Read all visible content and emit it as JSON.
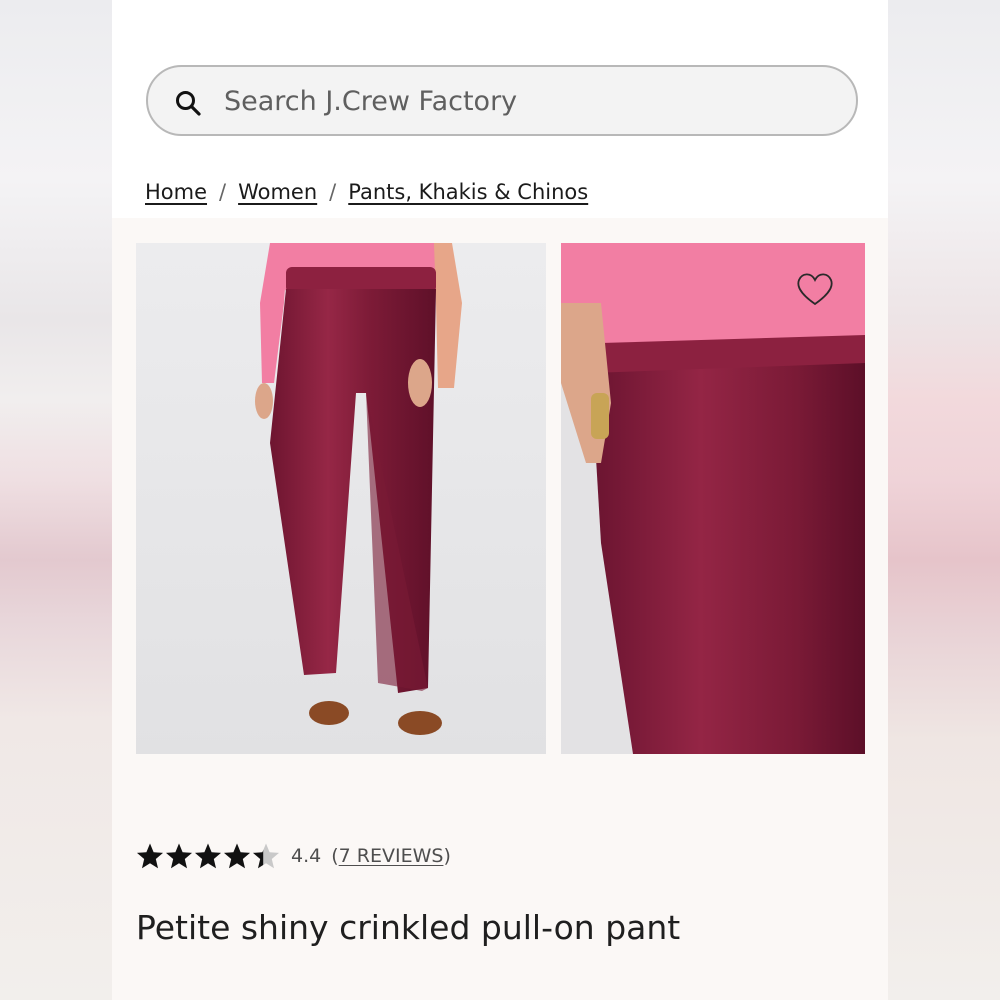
{
  "search": {
    "placeholder": "Search J.Crew Factory",
    "icon": "search-icon"
  },
  "breadcrumb": {
    "items": [
      "Home",
      "Women",
      "Pants, Khakis & Chinos"
    ],
    "separator": "/"
  },
  "product": {
    "rating_value": "4.4",
    "rating_stars": 4.4,
    "reviews_open": "(",
    "reviews_label": "7 REVIEWS",
    "reviews_close": ")",
    "title": "Petite shiny crinkled pull-on pant",
    "wishlist_icon": "heart-icon"
  },
  "colors": {
    "pant": "#8a1f3c",
    "sweater": "#f07aa0",
    "star": "#111111"
  }
}
